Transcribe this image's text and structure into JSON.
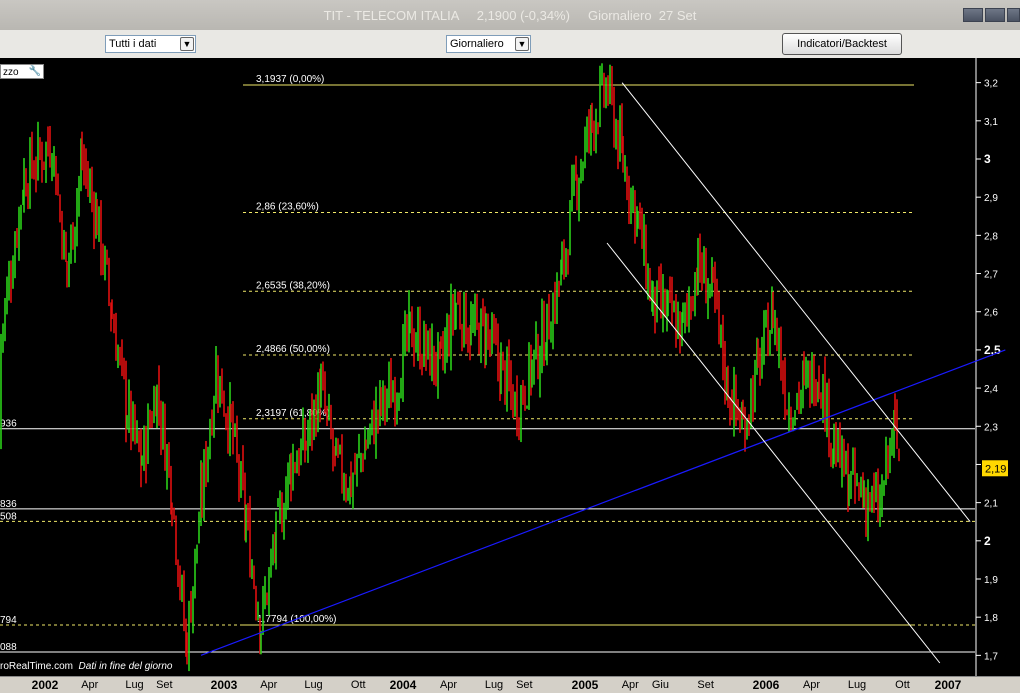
{
  "window": {
    "title": "TIT - TELECOM ITALIA     2,1900 (-0,34%)     Giornaliero  27 Set"
  },
  "toolbar": {
    "range_select": "Tutti i dati",
    "period_select": "Giornaliero",
    "indicators_button": "Indicatori/Backtest"
  },
  "panel": {
    "tab_label": "zzo"
  },
  "footer": {
    "source": "roRealTime.com",
    "note": "Dati in fine del giorno"
  },
  "colors": {
    "up": "#2ad01a",
    "down": "#e01010",
    "fib": "#f0e868",
    "trend": "#1a1aff",
    "channel": "#ffffff",
    "last_price": "#ffd800"
  },
  "icons": [
    "wrench-icon",
    "dropdown-arrow-icon",
    "minimize-icon",
    "maximize-icon",
    "close-icon"
  ],
  "chart_data": {
    "type": "candlestick",
    "title": "TIT - TELECOM ITALIA",
    "timeframe": "Giornaliero",
    "ylim": [
      1.68,
      3.22
    ],
    "y_ticks": [
      "3,2",
      "3,1",
      "3",
      "2,9",
      "2,8",
      "2,7",
      "2,6",
      "2,5",
      "2,4",
      "2,3",
      "2,2",
      "2,1",
      "2",
      "1,9",
      "1,8",
      "1,7"
    ],
    "y_tick_values": [
      3.2,
      3.1,
      3.0,
      2.9,
      2.8,
      2.7,
      2.6,
      2.5,
      2.4,
      2.3,
      2.2,
      2.1,
      2.0,
      1.9,
      1.8,
      1.7
    ],
    "x_ticks": [
      {
        "label": "2002",
        "major": true,
        "date": "2002-01"
      },
      {
        "label": "Apr",
        "major": false,
        "date": "2002-04"
      },
      {
        "label": "Lug",
        "major": false,
        "date": "2002-07"
      },
      {
        "label": "Set",
        "major": false,
        "date": "2002-09"
      },
      {
        "label": "2003",
        "major": true,
        "date": "2003-01"
      },
      {
        "label": "Apr",
        "major": false,
        "date": "2003-04"
      },
      {
        "label": "Lug",
        "major": false,
        "date": "2003-07"
      },
      {
        "label": "Ott",
        "major": false,
        "date": "2003-10"
      },
      {
        "label": "2004",
        "major": true,
        "date": "2004-01"
      },
      {
        "label": "Apr",
        "major": false,
        "date": "2004-04"
      },
      {
        "label": "Lug",
        "major": false,
        "date": "2004-07"
      },
      {
        "label": "Set",
        "major": false,
        "date": "2004-09"
      },
      {
        "label": "2005",
        "major": true,
        "date": "2005-01"
      },
      {
        "label": "Apr",
        "major": false,
        "date": "2005-04"
      },
      {
        "label": "Giu",
        "major": false,
        "date": "2005-06"
      },
      {
        "label": "Set",
        "major": false,
        "date": "2005-09"
      },
      {
        "label": "2006",
        "major": true,
        "date": "2006-01"
      },
      {
        "label": "Apr",
        "major": false,
        "date": "2006-04"
      },
      {
        "label": "Lug",
        "major": false,
        "date": "2006-07"
      },
      {
        "label": "Ott",
        "major": false,
        "date": "2006-10"
      },
      {
        "label": "2007",
        "major": true,
        "date": "2007-01"
      }
    ],
    "last_price": {
      "value": 2.19,
      "label": "2,19"
    },
    "fibonacci_levels": [
      {
        "value": 3.1937,
        "label": "3,1937 (0,00%)"
      },
      {
        "value": 2.86,
        "label": "2,86 (23,60%)"
      },
      {
        "value": 2.6535,
        "label": "2,6535 (38,20%)"
      },
      {
        "value": 2.4866,
        "label": "2,4866 (50,00%)"
      },
      {
        "value": 2.3197,
        "label": "2,3197 (61,80%)"
      },
      {
        "value": 1.7794,
        "label": "1,7794 (100,00%)"
      }
    ],
    "horizontal_lines": [
      {
        "value": 2.2936,
        "label": "936"
      },
      {
        "value": 2.0836,
        "label": "836"
      },
      {
        "value": 2.0508,
        "label": "508"
      },
      {
        "value": 1.7794,
        "label": "794"
      },
      {
        "value": 1.7088,
        "label": "088"
      }
    ],
    "trendline": {
      "from": {
        "date": "2002-11",
        "value": 1.7
      },
      "to": {
        "date": "2007-03",
        "value": 2.5
      }
    },
    "channel_lines": [
      {
        "from": {
          "date": "2005-03",
          "value": 3.2
        },
        "to": {
          "date": "2007-02",
          "value": 2.05
        }
      },
      {
        "from": {
          "date": "2005-02",
          "value": 2.78
        },
        "to": {
          "date": "2006-12",
          "value": 1.68
        }
      }
    ],
    "price_path": [
      {
        "date": "2001-11",
        "value": 2.25
      },
      {
        "date": "2001-12",
        "value": 2.95
      },
      {
        "date": "2002-01",
        "value": 3.05
      },
      {
        "date": "2002-02",
        "value": 2.7
      },
      {
        "date": "2002-03",
        "value": 3.0
      },
      {
        "date": "2002-04",
        "value": 2.85
      },
      {
        "date": "2002-05",
        "value": 2.6
      },
      {
        "date": "2002-06",
        "value": 2.35
      },
      {
        "date": "2002-07",
        "value": 2.2
      },
      {
        "date": "2002-08",
        "value": 2.4
      },
      {
        "date": "2002-09",
        "value": 2.15
      },
      {
        "date": "2002-10",
        "value": 1.72
      },
      {
        "date": "2002-11",
        "value": 2.1
      },
      {
        "date": "2002-12",
        "value": 2.45
      },
      {
        "date": "2003-01",
        "value": 2.3
      },
      {
        "date": "2003-02",
        "value": 2.05
      },
      {
        "date": "2003-03",
        "value": 1.78
      },
      {
        "date": "2003-04",
        "value": 2.0
      },
      {
        "date": "2003-05",
        "value": 2.2
      },
      {
        "date": "2003-06",
        "value": 2.25
      },
      {
        "date": "2003-07",
        "value": 2.4
      },
      {
        "date": "2003-08",
        "value": 2.2
      },
      {
        "date": "2003-09",
        "value": 2.15
      },
      {
        "date": "2003-10",
        "value": 2.25
      },
      {
        "date": "2003-11",
        "value": 2.35
      },
      {
        "date": "2003-12",
        "value": 2.4
      },
      {
        "date": "2004-01",
        "value": 2.55
      },
      {
        "date": "2004-02",
        "value": 2.5
      },
      {
        "date": "2004-03",
        "value": 2.45
      },
      {
        "date": "2004-04",
        "value": 2.62
      },
      {
        "date": "2004-05",
        "value": 2.55
      },
      {
        "date": "2004-06",
        "value": 2.55
      },
      {
        "date": "2004-07",
        "value": 2.45
      },
      {
        "date": "2004-08",
        "value": 2.35
      },
      {
        "date": "2004-09",
        "value": 2.45
      },
      {
        "date": "2004-10",
        "value": 2.55
      },
      {
        "date": "2004-11",
        "value": 2.7
      },
      {
        "date": "2004-12",
        "value": 2.95
      },
      {
        "date": "2005-01",
        "value": 3.1
      },
      {
        "date": "2005-02",
        "value": 3.19
      },
      {
        "date": "2005-03",
        "value": 3.0
      },
      {
        "date": "2005-04",
        "value": 2.85
      },
      {
        "date": "2005-05",
        "value": 2.62
      },
      {
        "date": "2005-06",
        "value": 2.6
      },
      {
        "date": "2005-07",
        "value": 2.55
      },
      {
        "date": "2005-08",
        "value": 2.72
      },
      {
        "date": "2005-09",
        "value": 2.65
      },
      {
        "date": "2005-10",
        "value": 2.4
      },
      {
        "date": "2005-11",
        "value": 2.3
      },
      {
        "date": "2005-12",
        "value": 2.45
      },
      {
        "date": "2006-01",
        "value": 2.6
      },
      {
        "date": "2006-02",
        "value": 2.35
      },
      {
        "date": "2006-03",
        "value": 2.4
      },
      {
        "date": "2006-04",
        "value": 2.45
      },
      {
        "date": "2006-05",
        "value": 2.25
      },
      {
        "date": "2006-06",
        "value": 2.15
      },
      {
        "date": "2006-07",
        "value": 2.12
      },
      {
        "date": "2006-08",
        "value": 2.08
      },
      {
        "date": "2006-09",
        "value": 2.3
      },
      {
        "date": "2006-09-27",
        "value": 2.19
      }
    ]
  }
}
